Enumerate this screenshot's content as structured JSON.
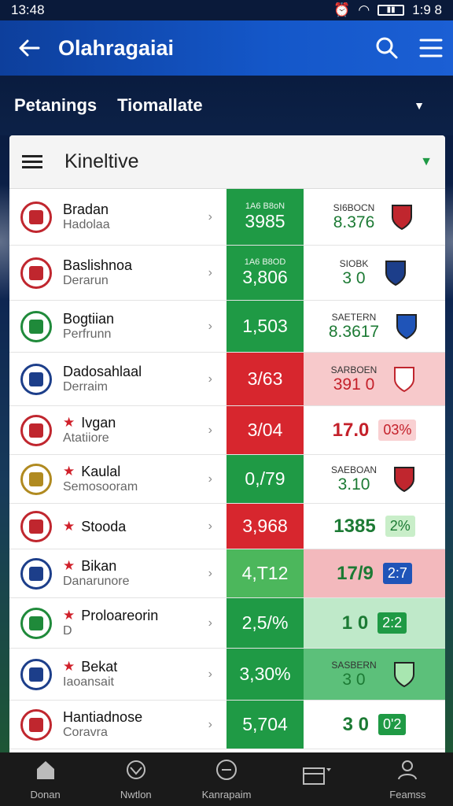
{
  "status": {
    "time": "13:48",
    "right_time": "1:9 8"
  },
  "appbar": {
    "title": "Olahragaiai"
  },
  "filters": {
    "items": [
      "Petanings",
      "Tiomallate"
    ]
  },
  "card": {
    "title": "Kineltive"
  },
  "colors": {
    "green": "#1f9a45",
    "red": "#d7262e",
    "appbar": "#1457c9"
  },
  "rows": [
    {
      "name": "Bradan",
      "sub": "Hadolaa",
      "star": "",
      "score_label": "1A6 B8oN",
      "score": "3985",
      "score_color": "green",
      "stat_label": "SI6BOCN",
      "stat_value": "8.376",
      "stat_bg": "#ffffff",
      "badge": "",
      "crest": "#c0262e",
      "crest_icon": "shield-crest"
    },
    {
      "name": "Baslishnoa",
      "sub": "Derarun",
      "star": "",
      "score_label": "1A6 B8OD",
      "score": "3,806",
      "score_color": "green",
      "stat_label": "SIOBK",
      "stat_value": "3 0",
      "stat_bg": "#ffffff",
      "badge": "",
      "crest": "#c0262e",
      "crest_icon": "shield-crest"
    },
    {
      "name": "Bogtiian",
      "sub": "Perfrunn",
      "star": "",
      "score_label": "",
      "score": "1,503",
      "score_color": "green",
      "stat_label": "SAETERN",
      "stat_value": "8.3617",
      "stat_bg": "#ffffff",
      "badge": "",
      "crest": "#1f8a3a",
      "crest_icon": "round-crest"
    },
    {
      "name": "Dadosahlaal",
      "sub": "Derraim",
      "star": "",
      "score_label": "",
      "score": "3/63",
      "score_color": "red",
      "stat_label": "SARBOEN",
      "stat_value": "391 0",
      "stat_bg": "#f7c9cb",
      "badge": "",
      "crest": "#1c3e8a",
      "crest_icon": "round-crest"
    },
    {
      "name": "Ivgan",
      "sub": "Atatiiore",
      "star": "★",
      "score_label": "",
      "score": "3/04",
      "score_color": "red",
      "stat_label": "",
      "stat_value": "17.0",
      "stat_bg": "#ffffff",
      "badge": "03%",
      "crest": "#c0262e",
      "crest_icon": "round-crest"
    },
    {
      "name": "Kaulal",
      "sub": "Semosooram",
      "star": "★",
      "score_label": "",
      "score": "0,/79",
      "score_color": "green",
      "stat_label": "SAEBOAN",
      "stat_value": "3.10",
      "stat_bg": "#ffffff",
      "badge": "",
      "crest": "#b08a20",
      "crest_icon": "eagle-crest"
    },
    {
      "name": "Stooda",
      "sub": "",
      "star": "★",
      "score_label": "",
      "score": "3,968",
      "score_color": "red",
      "stat_label": "",
      "stat_value": "1385",
      "stat_bg": "#ffffff",
      "badge": "2%",
      "crest": "#c0262e",
      "crest_icon": "round-crest"
    },
    {
      "name": "Bikan",
      "sub": "Danarunore",
      "star": "★",
      "score_label": "",
      "score": "4,T12",
      "score_color": "lightgreen",
      "stat_label": "",
      "stat_value": "17/9",
      "stat_bg": "#f3b9bd",
      "badge": "2:7",
      "crest": "#1c3e8a",
      "crest_icon": "shield-crest"
    },
    {
      "name": "Proloareorin",
      "sub": "D",
      "star": "★",
      "score_label": "",
      "score": "2,5/%",
      "score_color": "green",
      "stat_label": "",
      "stat_value": "1 0",
      "stat_bg": "#bfe9c9",
      "badge": "2:2",
      "crest": "#1f8a3a",
      "crest_icon": "round-crest"
    },
    {
      "name": "Bekat",
      "sub": "Iaoansait",
      "star": "★",
      "score_label": "",
      "score": "3,30%",
      "score_color": "green",
      "stat_label": "SASBERN",
      "stat_value": "3 0",
      "stat_bg": "#5cc07a",
      "badge": "",
      "crest": "#1c3e8a",
      "crest_icon": "flag-crest"
    },
    {
      "name": "Hantiadnose",
      "sub": "Coravra",
      "star": "",
      "score_label": "",
      "score": "5,704",
      "score_color": "green",
      "stat_label": "",
      "stat_value": "3 0",
      "stat_bg": "#ffffff",
      "badge": "0'2",
      "crest": "#c0262e",
      "crest_icon": "round-crest"
    }
  ],
  "tabs": [
    {
      "label": "Donan",
      "icon": "home-icon"
    },
    {
      "label": "Nwtlon",
      "icon": "ball-icon"
    },
    {
      "label": "Kanrapaim",
      "icon": "minus-circle-icon"
    },
    {
      "label": "",
      "icon": "window-icon"
    },
    {
      "label": "Feamss",
      "icon": "person-icon"
    }
  ]
}
